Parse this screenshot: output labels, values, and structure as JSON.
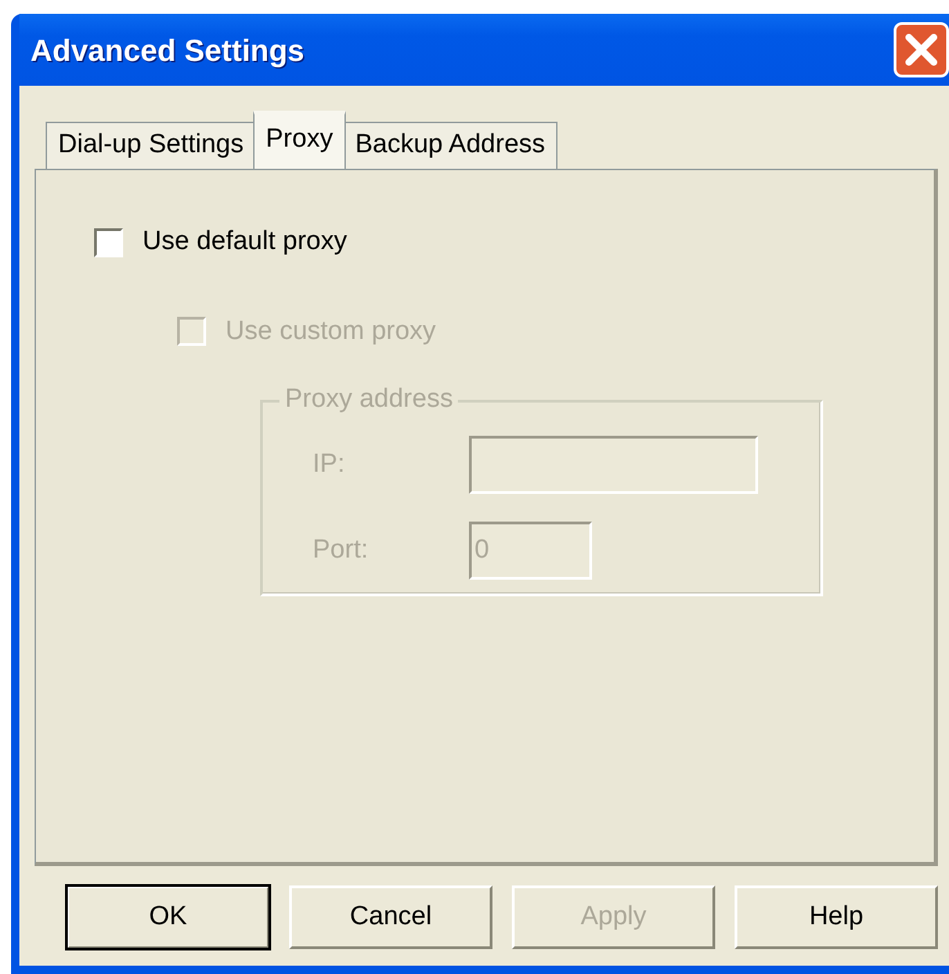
{
  "window": {
    "title": "Advanced Settings"
  },
  "tabs": [
    {
      "label": "Dial-up Settings",
      "selected": false
    },
    {
      "label": "Proxy",
      "selected": true
    },
    {
      "label": "Backup Address",
      "selected": false
    }
  ],
  "checkboxes": [
    {
      "label": "Use default proxy",
      "checked": false,
      "disabled": false
    },
    {
      "label": "Use custom proxy",
      "checked": false,
      "disabled": true
    }
  ],
  "proxy_address": {
    "title": "Proxy address",
    "disabled": true,
    "fields": [
      {
        "label": "IP:",
        "kind": "wide"
      },
      {
        "label": "Port:",
        "value": "0",
        "kind": "narrow"
      }
    ]
  },
  "buttons": [
    {
      "label": "OK",
      "default": true,
      "disabled": false
    },
    {
      "label": "Cancel",
      "default": false,
      "disabled": false
    },
    {
      "label": "Apply",
      "default": false,
      "disabled": true
    },
    {
      "label": "Help",
      "default": false,
      "disabled": false
    }
  ]
}
